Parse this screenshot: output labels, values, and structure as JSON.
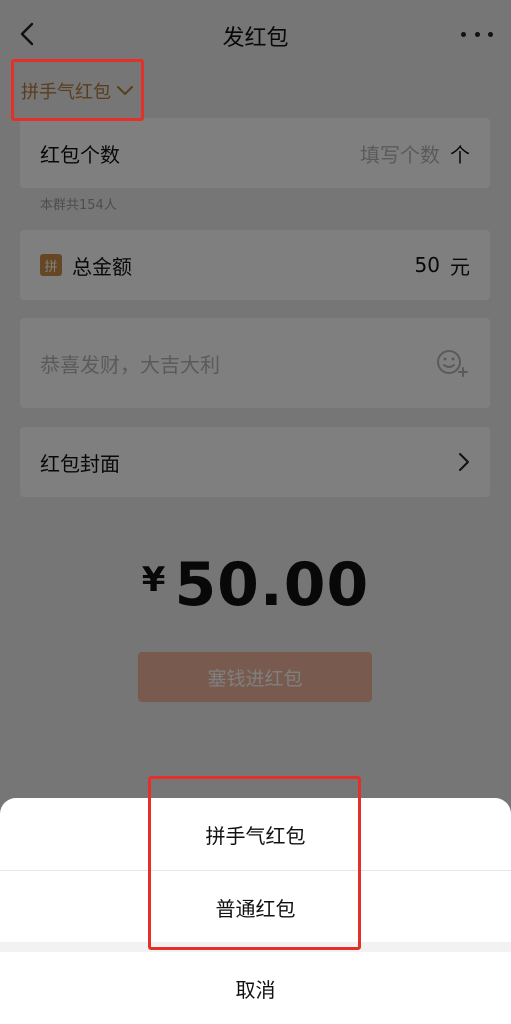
{
  "header": {
    "title": "发红包"
  },
  "type_selector": {
    "label": "拼手气红包"
  },
  "count_field": {
    "label": "红包个数",
    "placeholder": "填写个数",
    "unit": "个"
  },
  "group_note": "本群共154人",
  "amount_field": {
    "badge": "拼",
    "label": "总金额",
    "value": "50",
    "unit": "元"
  },
  "greeting_field": {
    "placeholder": "恭喜发财，大吉大利"
  },
  "cover_field": {
    "label": "红包封面"
  },
  "total": {
    "currency": "¥",
    "amount": "50.00"
  },
  "submit_button": {
    "label": "塞钱进红包"
  },
  "action_sheet": {
    "options": [
      "拼手气红包",
      "普通红包"
    ],
    "cancel": "取消"
  },
  "colors": {
    "accent": "#b57a3a",
    "annotation": "#e5302a",
    "badge": "#cc8f46",
    "submit": "#f1b79d"
  }
}
